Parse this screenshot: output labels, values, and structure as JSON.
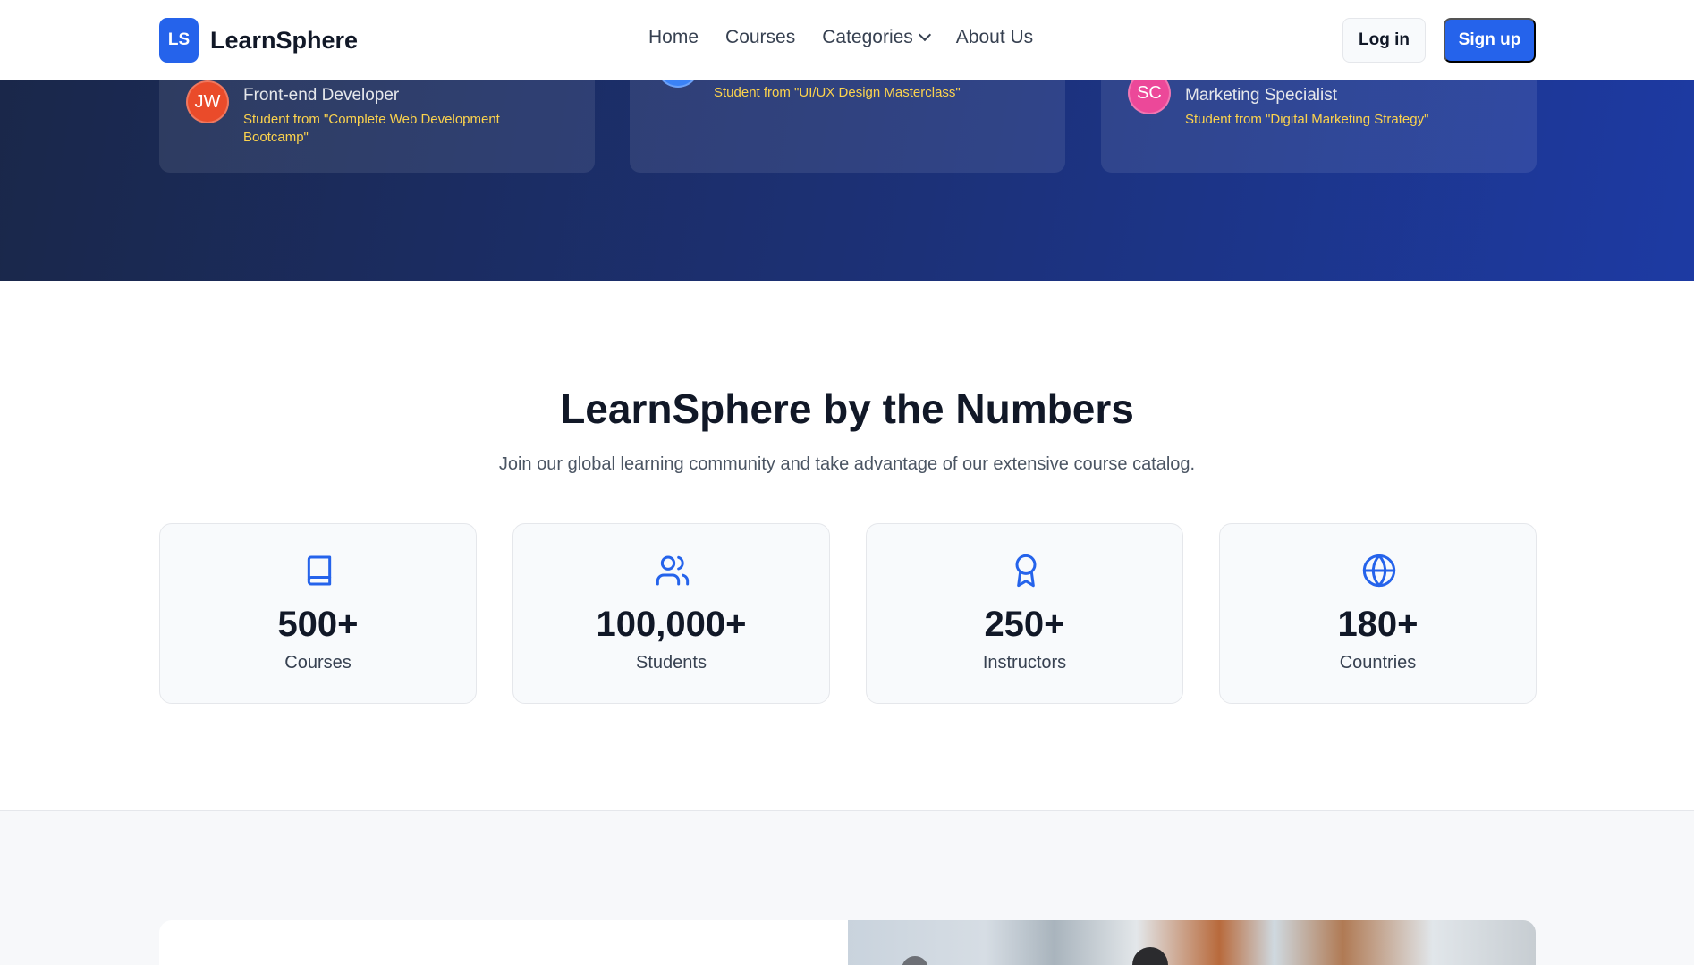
{
  "header": {
    "logo_text": "LS",
    "brand": "LearnSphere",
    "nav": [
      {
        "label": "Home"
      },
      {
        "label": "Courses"
      },
      {
        "label": "Categories"
      },
      {
        "label": "About Us"
      }
    ],
    "login_label": "Log in",
    "signup_label": "Sign up"
  },
  "testimonials": [
    {
      "initials": "JW",
      "role": "Front-end Developer",
      "source": "Student from \"Complete Web Development Bootcamp\"",
      "color": "#ea4b2a"
    },
    {
      "initials": "",
      "role": "",
      "source": "Student from \"UI/UX Design Masterclass\"",
      "color": "#3b82f6"
    },
    {
      "initials": "SC",
      "role": "Marketing Specialist",
      "source": "Student from \"Digital Marketing Strategy\"",
      "color": "#ec4899"
    }
  ],
  "stats": {
    "title": "LearnSphere by the Numbers",
    "subtitle": "Join our global learning community and take advantage of our extensive course catalog.",
    "items": [
      {
        "icon": "book-icon",
        "value": "500+",
        "label": "Courses"
      },
      {
        "icon": "users-icon",
        "value": "100,000+",
        "label": "Students"
      },
      {
        "icon": "award-icon",
        "value": "250+",
        "label": "Instructors"
      },
      {
        "icon": "globe-icon",
        "value": "180+",
        "label": "Countries"
      }
    ]
  },
  "colors": {
    "accent": "#2563eb",
    "band_dark": "#1a2749",
    "band_blue": "#1d3aa3",
    "source_text": "#fcd34d"
  }
}
